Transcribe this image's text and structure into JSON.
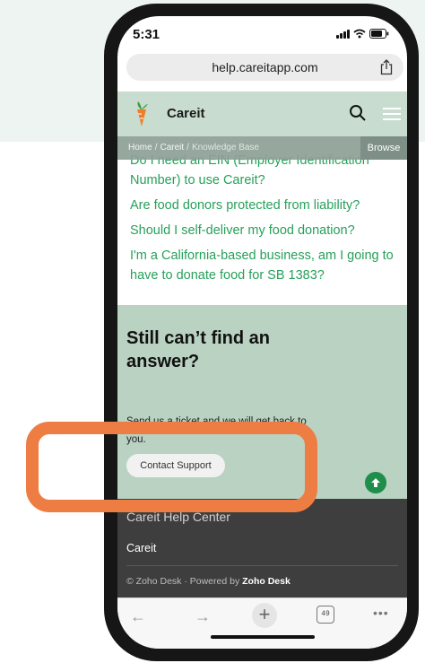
{
  "status_bar": {
    "time": "5:31"
  },
  "browser": {
    "url": "help.careitapp.com",
    "tab_count": "49"
  },
  "site": {
    "brand": "Careit"
  },
  "breadcrumb": {
    "home": "Home",
    "careit": "Careit",
    "current": "Knowledge Base",
    "browse": "Browse"
  },
  "articles": [
    "Do I need an EIN (Employer Identification Number) to use Careit?",
    "Are food donors protected from liability?",
    "Should I self-deliver my food donation?",
    "I'm a California-based business, am I going to have to donate food for SB 1383?"
  ],
  "help": {
    "title": "Still can’t find an answer?",
    "text": "Send us a ticket and we will get back to you.",
    "button": "Contact Support"
  },
  "footer": {
    "title": "Careit Help Center",
    "link": "Careit",
    "credit_prefix": "© Zoho Desk · Powered by ",
    "credit_brand": "Zoho Desk"
  },
  "colors": {
    "header_bg": "#c8ddcf",
    "link_green": "#27a05a",
    "highlight": "#ee7d43",
    "footer_bg": "#3e3e3e"
  }
}
